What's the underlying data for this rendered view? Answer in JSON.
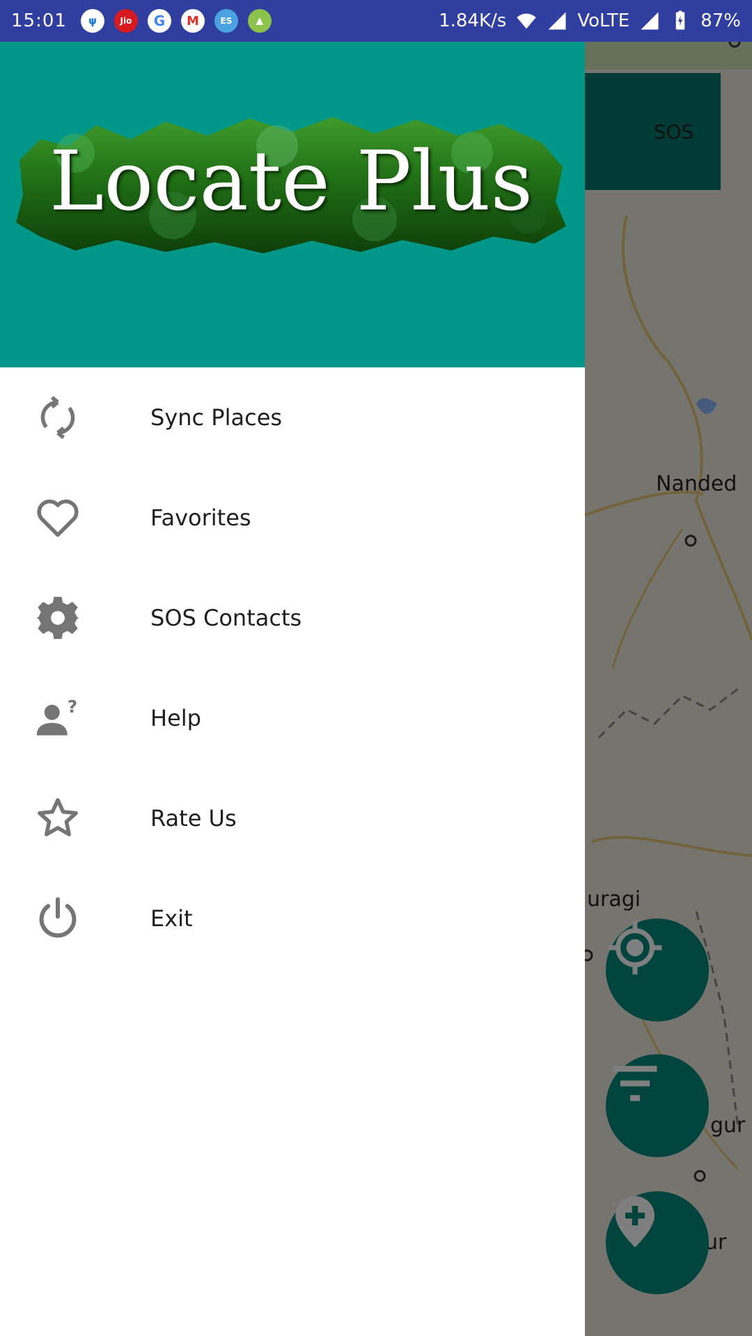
{
  "status_bar": {
    "time": "15:01",
    "notifications": [
      {
        "icon": "usb-icon",
        "glyph": "ψ"
      },
      {
        "icon": "jio-icon",
        "glyph": "Jio"
      },
      {
        "icon": "google-icon",
        "glyph": "G"
      },
      {
        "icon": "gmail-icon",
        "glyph": "M"
      },
      {
        "icon": "es-file-icon",
        "glyph": "ES"
      },
      {
        "icon": "android-icon",
        "glyph": "▲"
      }
    ],
    "network_speed": "1.84K/s",
    "volte": "VoLTE",
    "battery": "87%"
  },
  "drawer": {
    "logo_text": "Locate Plus",
    "items": [
      {
        "label": "Sync Places",
        "icon": "sync-icon"
      },
      {
        "label": "Favorites",
        "icon": "heart-icon"
      },
      {
        "label": "SOS Contacts",
        "icon": "gear-icon"
      },
      {
        "label": "Help",
        "icon": "person-help-icon"
      },
      {
        "label": "Rate Us",
        "icon": "star-icon"
      },
      {
        "label": "Exit",
        "icon": "power-icon"
      }
    ]
  },
  "map": {
    "sos_label": "SOS",
    "places": [
      "Nanded",
      "uragi",
      "gur",
      "ur"
    ]
  },
  "colors": {
    "status_bar": "#303f9f",
    "drawer_header": "#009688",
    "fab": "#00897b",
    "icon_gray": "#757575"
  }
}
